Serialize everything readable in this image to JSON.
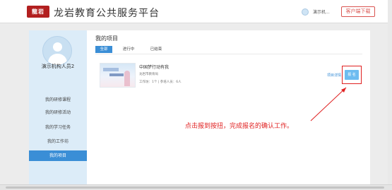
{
  "header": {
    "logo_text": "龍岩",
    "title": "龙岩教育公共服务平台",
    "user_name": "演示机...",
    "client_download": "客户端下载"
  },
  "sidebar": {
    "user_name": "演示机构人员2",
    "items": [
      {
        "label": "我的研修课程"
      },
      {
        "label": "我的研修活动"
      },
      {
        "label": "我的学习任务"
      },
      {
        "label": "我的工作坊"
      },
      {
        "label": "我的项目",
        "active": true
      }
    ]
  },
  "main": {
    "title": "我的项目",
    "tabs": [
      {
        "label": "全部",
        "active": true
      },
      {
        "label": "进行中"
      },
      {
        "label": "已结束"
      }
    ],
    "project": {
      "thumb_text": "中国梦",
      "title": "中国梦行动有我",
      "org": "龙岩市教育局",
      "meta": "工作坊：1个 | 参培人员：6人",
      "detail_link": "项目详情",
      "enroll_button": "报 名"
    }
  },
  "annotation": {
    "text": "点击报到按扭，完成报名的确认工作。",
    "color": "#e02020"
  },
  "colors": {
    "accent": "#3a8ed6",
    "brand": "#b21f1f",
    "sidebar_bg": "#dcecf8",
    "enroll_button": "#6dbcf0"
  }
}
